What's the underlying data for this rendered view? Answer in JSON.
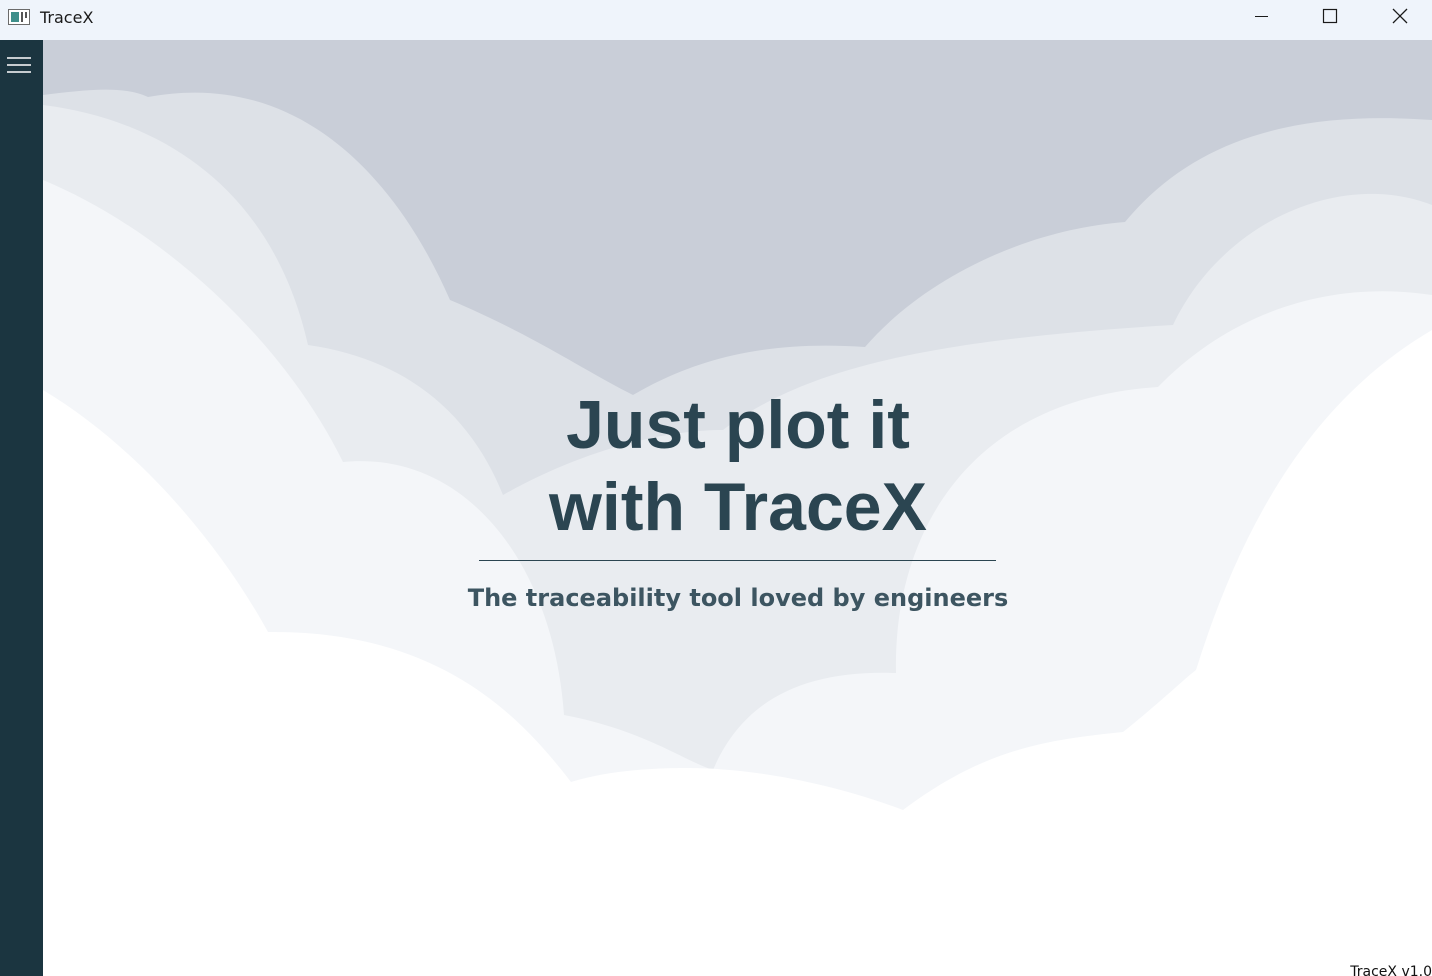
{
  "window": {
    "title": "TraceX",
    "controls": {
      "minimize_icon": "minimize-icon",
      "maximize_icon": "maximize-icon",
      "close_icon": "close-icon"
    }
  },
  "sidebar": {
    "menu_icon": "hamburger-menu-icon",
    "background": "#1b3540"
  },
  "hero": {
    "headline_line1": "Just plot it",
    "headline_line2": "with TraceX",
    "subtitle": "The traceability tool loved by engineers",
    "text_color": "#2b4551"
  },
  "footer": {
    "version": "TraceX v1.0"
  },
  "colors": {
    "titlebar": "#eff4fb",
    "cloud_dark": "#c9ced8",
    "cloud_mid": "#dde1e7",
    "cloud_light": "#e9ecf0",
    "cloud_lighter": "#f4f6f9",
    "background": "#ffffff"
  }
}
